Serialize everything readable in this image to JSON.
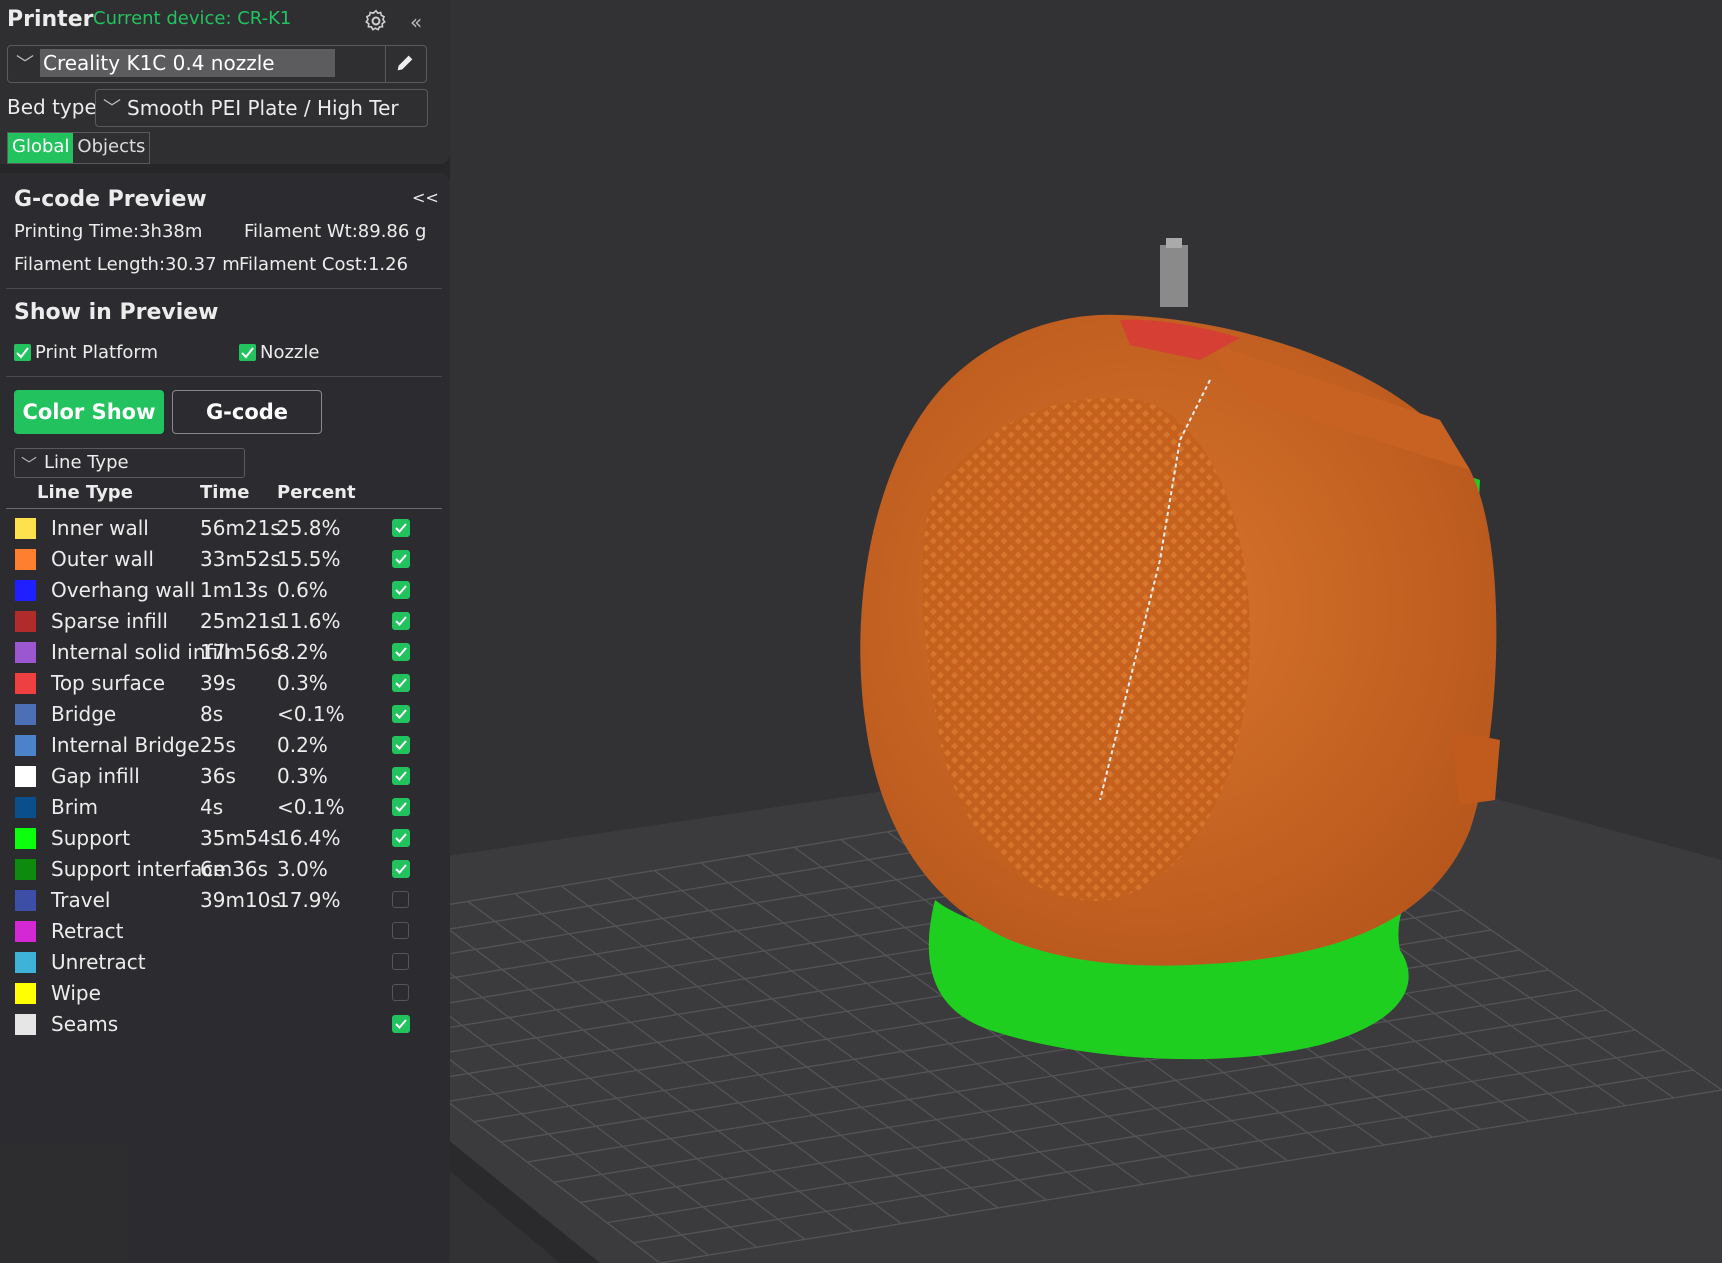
{
  "printer": {
    "title": "Printer",
    "current_device": "Current device: CR-K1",
    "preset": "Creality K1C 0.4 nozzle",
    "bed_type_label": "Bed type",
    "bed_type_value": "Smooth PEI Plate / High Ter",
    "tabs": [
      "Global",
      "Objects"
    ],
    "collapse": "«"
  },
  "gcode": {
    "title": "G-code Preview",
    "collapse": "<<",
    "printing_time": "Printing Time:3h38m",
    "filament_wt": "Filament Wt:89.86 g",
    "filament_length": "Filament Length:30.37 m",
    "filament_cost": "Filament Cost:1.26"
  },
  "show_preview": {
    "title": "Show in Preview",
    "print_platform": "Print Platform",
    "nozzle": "Nozzle",
    "color_show": "Color Show",
    "gcode_btn": "G-code",
    "line_type_select": "Line Type"
  },
  "table": {
    "headers": [
      "Line Type",
      "Time",
      "Percent"
    ],
    "rows": [
      {
        "name": "Inner wall",
        "time": "56m21s",
        "pct": "25.8%",
        "color": "#ffe04d",
        "checked": true
      },
      {
        "name": "Outer wall",
        "time": "33m52s",
        "pct": "15.5%",
        "color": "#ff7f30",
        "checked": true
      },
      {
        "name": "Overhang wall",
        "time": "1m13s",
        "pct": "0.6%",
        "color": "#1f1fff",
        "checked": true
      },
      {
        "name": "Sparse infill",
        "time": "25m21s",
        "pct": "11.6%",
        "color": "#b02c2c",
        "checked": true
      },
      {
        "name": "Internal solid infill",
        "time": "17m56s",
        "pct": "8.2%",
        "color": "#9a57d0",
        "checked": true
      },
      {
        "name": "Top surface",
        "time": "39s",
        "pct": "0.3%",
        "color": "#ee4040",
        "checked": true
      },
      {
        "name": "Bridge",
        "time": "8s",
        "pct": "<0.1%",
        "color": "#4d6fb5",
        "checked": true
      },
      {
        "name": "Internal Bridge",
        "time": "25s",
        "pct": "0.2%",
        "color": "#4b82c9",
        "checked": true
      },
      {
        "name": "Gap infill",
        "time": "36s",
        "pct": "0.3%",
        "color": "#ffffff",
        "checked": true
      },
      {
        "name": "Brim",
        "time": "4s",
        "pct": "<0.1%",
        "color": "#0a4f8c",
        "checked": true
      },
      {
        "name": "Support",
        "time": "35m54s",
        "pct": "16.4%",
        "color": "#0cff0c",
        "checked": true
      },
      {
        "name": "Support interface",
        "time": "6m36s",
        "pct": "3.0%",
        "color": "#0e8a0e",
        "checked": true
      },
      {
        "name": "Travel",
        "time": "39m10s",
        "pct": "17.9%",
        "color": "#3d4ea6",
        "checked": false
      },
      {
        "name": "Retract",
        "time": "",
        "pct": "",
        "color": "#d428d4",
        "checked": false
      },
      {
        "name": "Unretract",
        "time": "",
        "pct": "",
        "color": "#3fb2d8",
        "checked": false
      },
      {
        "name": "Wipe",
        "time": "",
        "pct": "",
        "color": "#ffff00",
        "checked": false
      },
      {
        "name": "Seams",
        "time": "",
        "pct": "",
        "color": "#e6e6e6",
        "checked": true
      }
    ]
  },
  "colors": {
    "accent": "#22c35e",
    "panel": "#2f2f32",
    "background": "#313133"
  }
}
